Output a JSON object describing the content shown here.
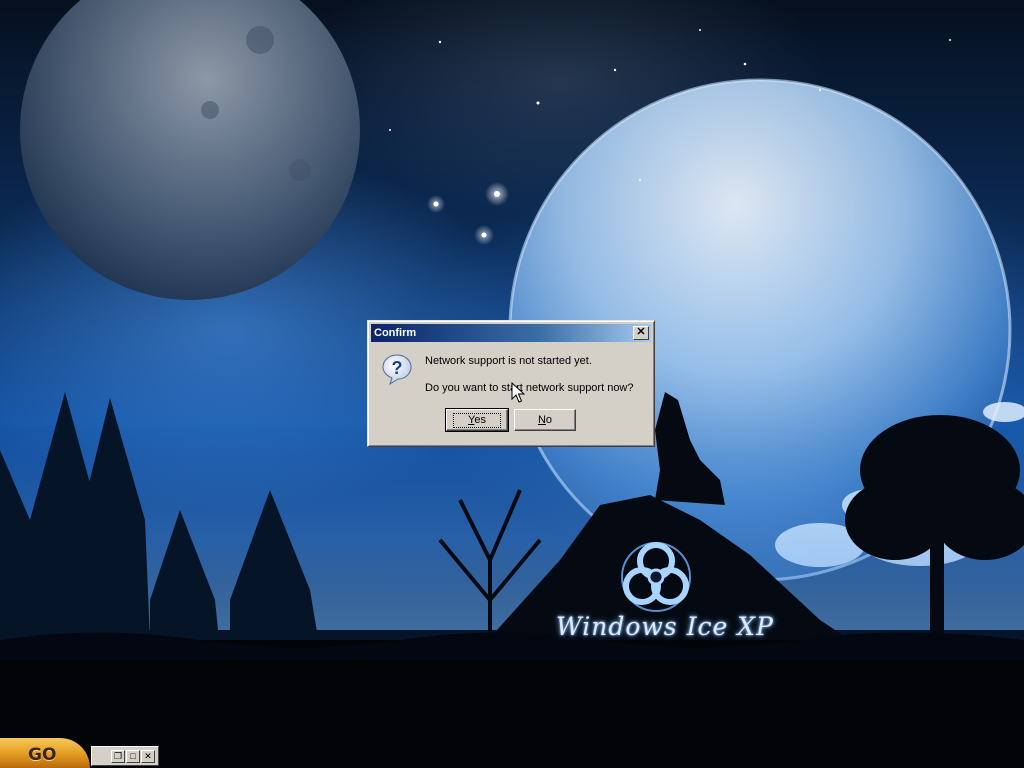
{
  "desktop": {
    "logo_text": "Windows Ice XP"
  },
  "dialog": {
    "title": "Confirm",
    "close_glyph": "✕",
    "icon": "question-icon",
    "message_line1": "Network support is not started yet.",
    "message_line2": "Do you want to start network support now?",
    "yes_label": "Yes",
    "no_label": "No"
  },
  "taskbar": {
    "go_label": "GO",
    "restore_glyph": "❐",
    "maximize_glyph": "□",
    "close_glyph": "✕"
  },
  "colors": {
    "titlebar_start": "#0a246a",
    "titlebar_end": "#a6caf0",
    "dialog_face": "#d4d0c8",
    "go_button": "#e39a1f"
  }
}
